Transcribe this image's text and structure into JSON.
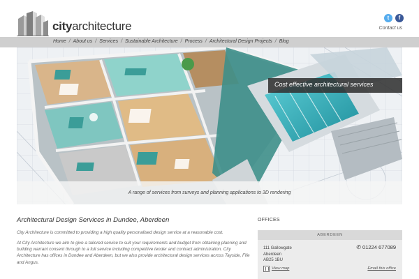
{
  "brand": {
    "name_bold": "city",
    "name_rest": "architecture",
    "colors": {
      "accent_teal": "#3b9d98",
      "nav_gray": "#cfcfcf",
      "twitter": "#55acee",
      "facebook": "#3b5998"
    }
  },
  "header": {
    "social": [
      {
        "icon": "twitter-icon",
        "glyph": "t"
      },
      {
        "icon": "facebook-icon",
        "glyph": "f"
      }
    ],
    "contact_link": "Contact us"
  },
  "nav": {
    "items": [
      "Home",
      "About us",
      "Services",
      "Sustainable Architecture",
      "Process",
      "Architectural Design Projects",
      "Blog"
    ],
    "separator": "/"
  },
  "hero": {
    "badge": "Cost effective architectural services",
    "caption": "A range of services from surveys and planning applications to 3D rendering"
  },
  "main": {
    "heading": "Architectural Design Services in Dundee, Aberdeen",
    "paragraphs": [
      "City Architecture is committed to providing a high quality personalised design service at a reasonable cost.",
      "At City Architecture we aim to give a tailored service to suit your requirements and budget from obtaining planning and building warrant consent through to a full service including competitive tender and contract administration. City Architecture has offices in Dundee and Aberdeen, but we also provide architectural design services across Tayside, Fife and Angus."
    ]
  },
  "offices": {
    "heading": "OFFICES",
    "card": {
      "name": "ABERDEEN",
      "address": [
        "111 Gallowgate",
        "Aberdeen",
        "AB25 1BU"
      ],
      "phone": "01224 677089",
      "view_map": "View map",
      "email": "Email this office"
    }
  }
}
